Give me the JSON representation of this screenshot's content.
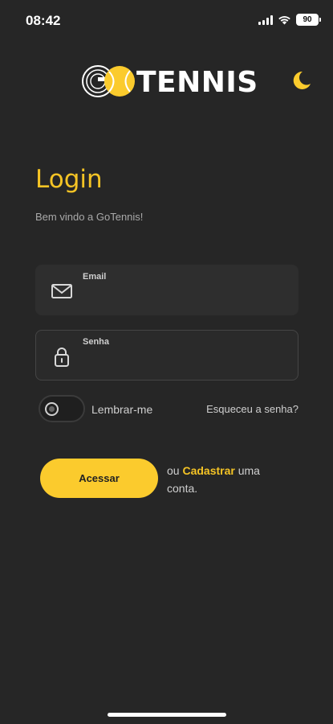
{
  "status_bar": {
    "time": "08:42",
    "battery": "90",
    "icons": [
      "signal-icon",
      "wifi-icon",
      "battery-icon"
    ]
  },
  "header": {
    "logo_text": "TENNIS",
    "theme_toggle_icon": "moon-icon"
  },
  "login": {
    "title": "Login",
    "subtitle": "Bem vindo a GoTennis!",
    "email": {
      "label": "Email",
      "value": "",
      "icon": "mail-icon"
    },
    "password": {
      "label": "Senha",
      "value": "",
      "icon": "lock-icon"
    },
    "remember": {
      "label": "Lembrar-me",
      "checked": false
    },
    "forgot_link": "Esqueceu a senha?",
    "submit_label": "Acessar",
    "signup_prefix": "ou ",
    "signup_link": "Cadastrar",
    "signup_suffix": " uma conta."
  },
  "colors": {
    "background": "#262626",
    "accent": "#f5c425",
    "button": "#fbcb2d"
  }
}
